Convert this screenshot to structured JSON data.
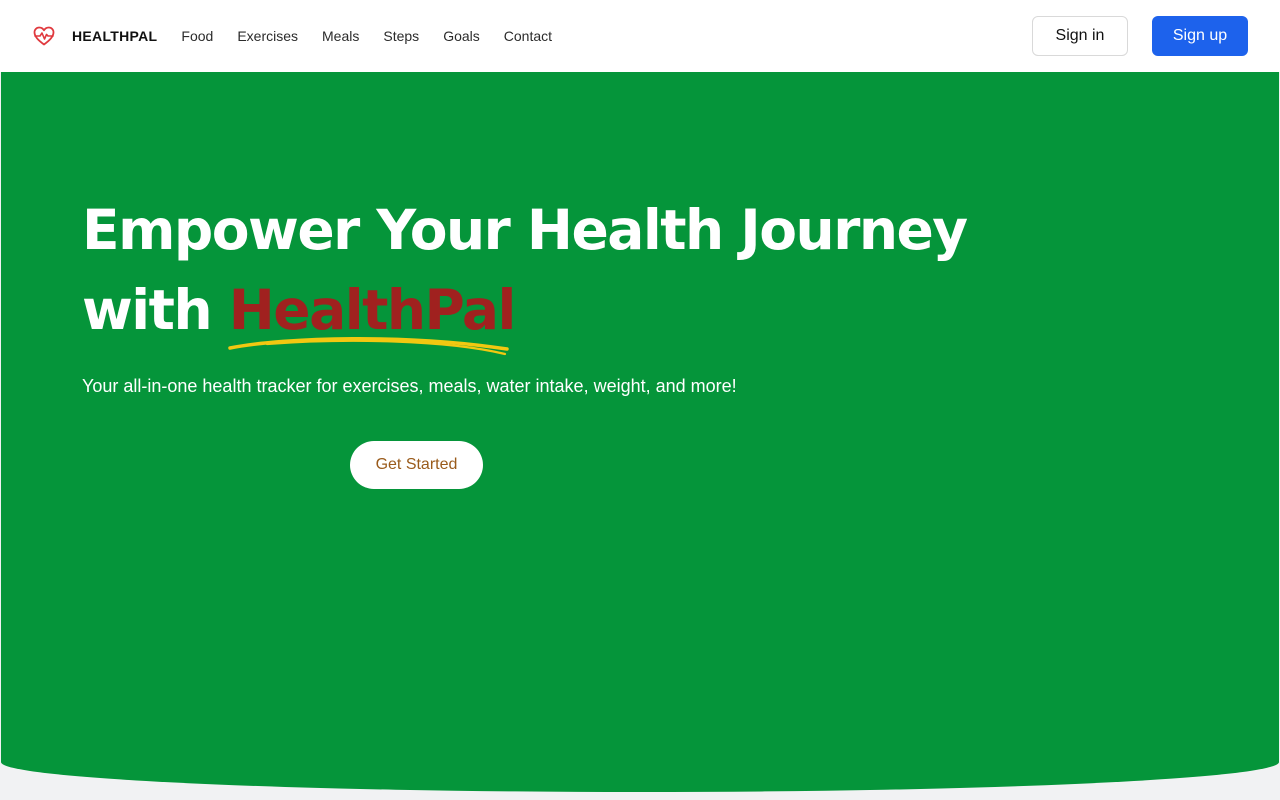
{
  "brand": {
    "name": "HEALTHPAL",
    "logo_icon": "heart-pulse-icon",
    "logo_color": "#e0393e"
  },
  "nav": {
    "links": [
      "Food",
      "Exercises",
      "Meals",
      "Steps",
      "Goals",
      "Contact"
    ]
  },
  "auth": {
    "signin_label": "Sign in",
    "signup_label": "Sign up"
  },
  "hero": {
    "title_line1": "Empower Your Health Journey",
    "title_prefix": "with ",
    "title_accent": "HealthPal",
    "subtitle": "Your all-in-one health tracker for exercises, meals, water intake, weight, and more!",
    "cta_label": "Get Started"
  },
  "colors": {
    "hero_bg": "#05953a",
    "accent_text": "#a0211f",
    "underline": "#f2c811",
    "primary_button": "#1d62ec",
    "cta_text": "#9a5b1b"
  }
}
